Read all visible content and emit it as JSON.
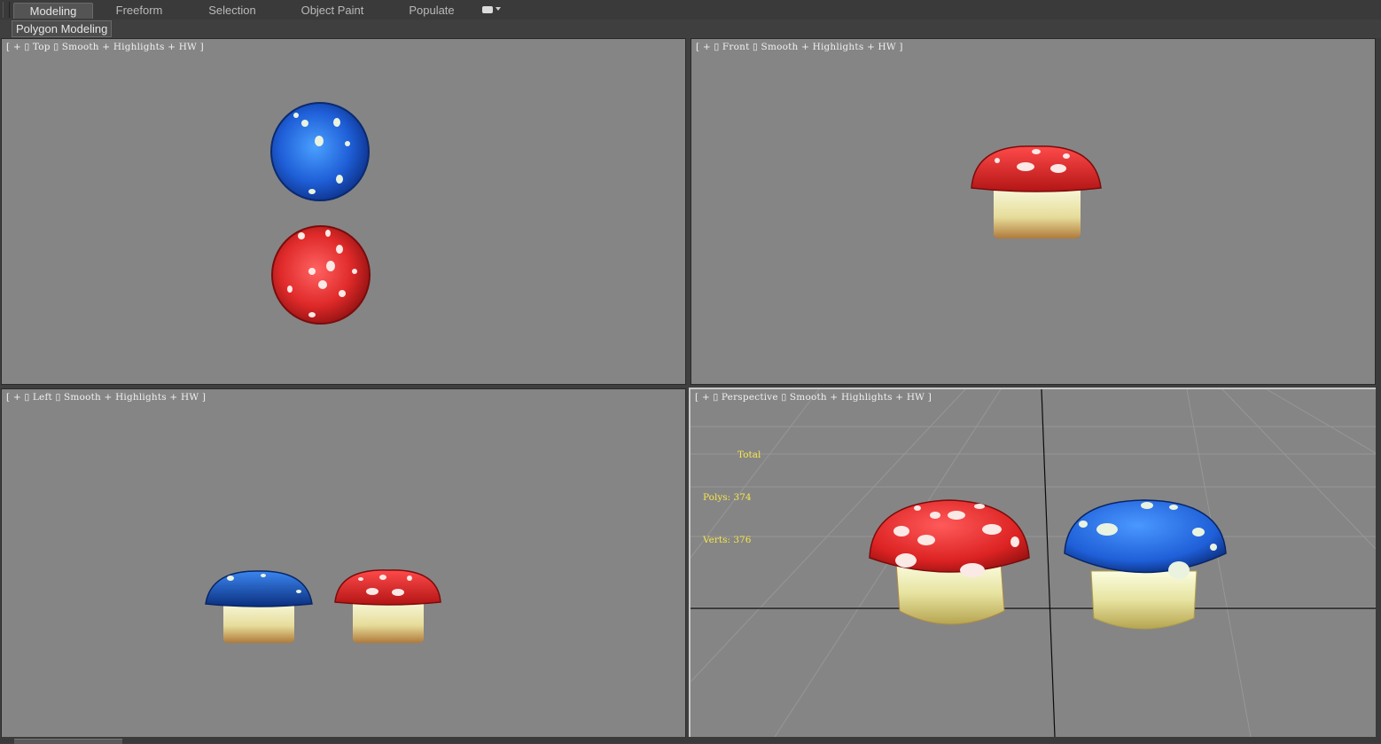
{
  "ribbon": {
    "tabs": [
      {
        "label": "Modeling",
        "active": true
      },
      {
        "label": "Freeform",
        "active": false
      },
      {
        "label": "Selection",
        "active": false
      },
      {
        "label": "Object Paint",
        "active": false
      },
      {
        "label": "Populate",
        "active": false
      }
    ],
    "menu_icon": "dropdown-menu-icon",
    "panel_label": "Polygon Modeling"
  },
  "viewports": {
    "top": {
      "label": "[ + ▯ Top ▯ Smooth + Highlights + HW ]"
    },
    "front": {
      "label": "[ + ▯ Front ▯ Smooth + Highlights + HW ]"
    },
    "left": {
      "label": "[ + ▯ Left ▯ Smooth + Highlights + HW ]"
    },
    "perspective": {
      "label": "[ + ▯ Perspective ▯ Smooth + Highlights + HW ]",
      "stats": {
        "title": "Total",
        "polys": "Polys: 374",
        "verts": "Verts: 376"
      }
    }
  },
  "colors": {
    "viewport_bg": "#858585",
    "stats_text": "#f6e64b",
    "red_cap": "#e02a2a",
    "blue_cap": "#1f5fd8",
    "stem": "#e9e7b0"
  }
}
